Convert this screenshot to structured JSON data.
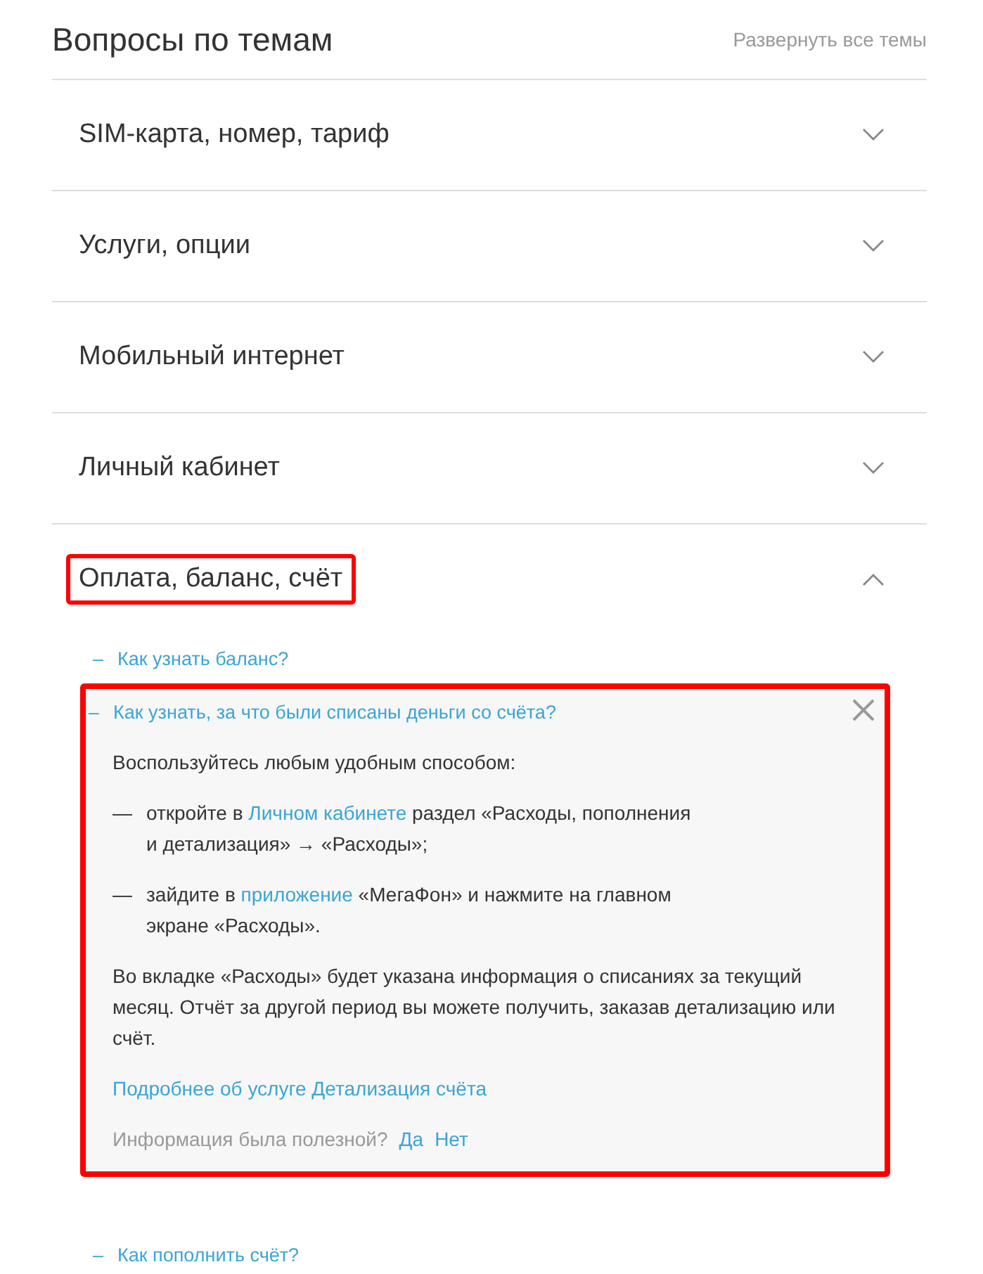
{
  "header": {
    "title": "Вопросы по темам",
    "expand_all": "Развернуть все темы"
  },
  "topics": [
    {
      "title": "SIM-карта, номер, тариф",
      "expanded": false,
      "highlighted": false
    },
    {
      "title": "Услуги, опции",
      "expanded": false,
      "highlighted": false
    },
    {
      "title": "Мобильный интернет",
      "expanded": false,
      "highlighted": false
    },
    {
      "title": "Личный кабинет",
      "expanded": false,
      "highlighted": false
    },
    {
      "title": "Оплата, баланс, счёт",
      "expanded": true,
      "highlighted": true,
      "questions": [
        {
          "marker": "–",
          "title": "Как узнать баланс?",
          "expanded": false,
          "highlighted": false
        },
        {
          "marker": "–",
          "title": "Как узнать, за что были списаны деньги со счёта?",
          "expanded": true,
          "highlighted": true,
          "answer": {
            "intro": "Воспользуйтесь любым удобным способом:",
            "bullets": [
              {
                "marker": "—",
                "parts": [
                  {
                    "kind": "text",
                    "text": "откройте в "
                  },
                  {
                    "kind": "link",
                    "text": "Личном кабинете"
                  },
                  {
                    "kind": "text",
                    "text": " раздел «Расходы, пополнения и детализация» → «Расходы»;"
                  }
                ]
              },
              {
                "marker": "—",
                "parts": [
                  {
                    "kind": "text",
                    "text": "зайдите в "
                  },
                  {
                    "kind": "link",
                    "text": "приложение"
                  },
                  {
                    "kind": "text",
                    "text": " «МегаФон» и нажмите на главном экране «Расходы»."
                  }
                ]
              }
            ],
            "paragraph": "Во вкладке «Расходы» будет указана информация о списаниях за текущий месяц. Отчёт за другой период вы можете получить, заказав детализацию или счёт.",
            "more_link": "Подробнее об услуге Детализация счёта",
            "feedback": {
              "prompt": "Информация была полезной?",
              "yes": "Да",
              "no": "Нет"
            }
          }
        },
        {
          "marker": "–",
          "title": "Как пополнить счёт?",
          "expanded": false,
          "highlighted": false
        }
      ]
    }
  ]
}
